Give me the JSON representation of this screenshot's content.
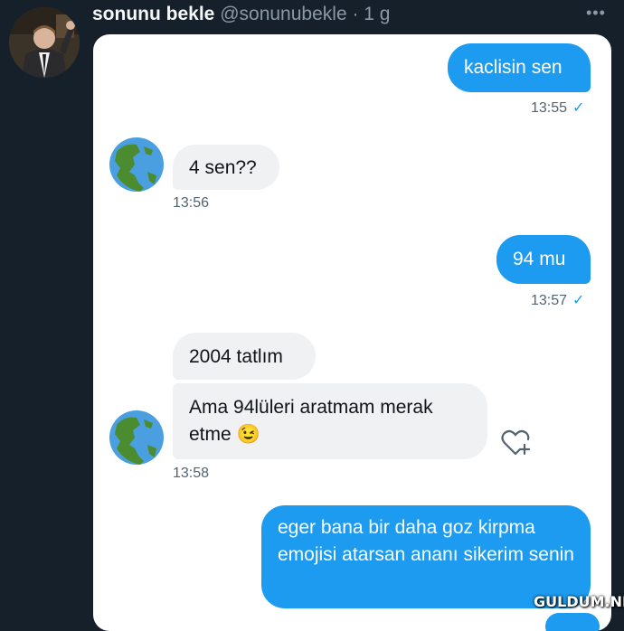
{
  "tweet": {
    "display_name": "sonunu bekle",
    "handle": "@sonunubekle",
    "time": "1 g",
    "separator": " · "
  },
  "messages": [
    {
      "text": "kaclisin sen",
      "time": "13:55",
      "read": "✓"
    },
    {
      "text": "4 sen??",
      "time": "13:56"
    },
    {
      "text": "94 mu",
      "time": "13:57",
      "read": "✓"
    },
    {
      "text": "2004 tatlım"
    },
    {
      "text": "Ama 94lüleri aratmam merak",
      "text_line2": "etme",
      "emoji": "😉",
      "time": "13:58"
    },
    {
      "text": "eger bana bir daha goz kirpma emojisi atarsan ananı sikerim senin"
    }
  ],
  "watermark": "GULDUM.NET",
  "colors": {
    "background": "#15202b",
    "accent": "#1d9bf0",
    "incoming": "#eff1f3"
  },
  "icons": {
    "more": "more-horizontal-icon",
    "avatar": "globe-americas-icon",
    "reaction": "heart-plus-icon"
  }
}
